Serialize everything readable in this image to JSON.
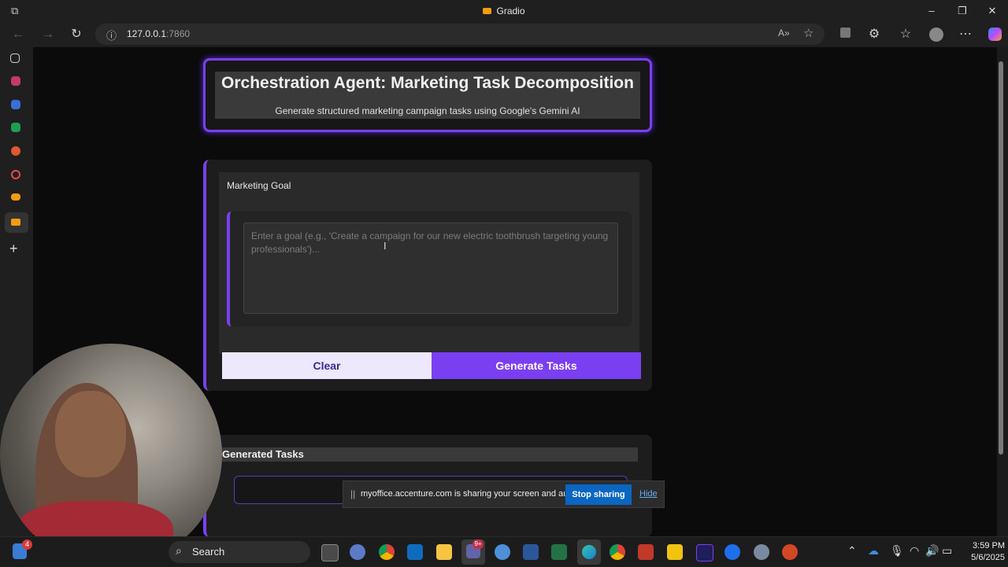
{
  "window": {
    "title": "Gradio",
    "controls": {
      "minimize": "–",
      "restore": "❐",
      "close": "✕"
    }
  },
  "browser": {
    "url_host": "127.0.0.1",
    "url_port": ":7860",
    "icons": [
      "back-icon",
      "forward-icon",
      "refresh-icon",
      "info-icon",
      "read-aloud-icon",
      "favorite-star-icon",
      "extensions-icon",
      "favorites-icon",
      "profile-icon",
      "more-icon",
      "copilot-icon"
    ]
  },
  "header": {
    "title": "Orchestration Agent: Marketing Task Decomposition",
    "subtitle": "Generate structured marketing campaign tasks using Google's Gemini AI"
  },
  "goal": {
    "label": "Marketing Goal",
    "placeholder": "Enter a goal (e.g., 'Create a campaign for our new electric toothbrush targeting young professionals')...",
    "value": ""
  },
  "buttons": {
    "clear": "Clear",
    "generate": "Generate Tasks"
  },
  "tasks": {
    "heading": "Generated Tasks"
  },
  "sharing": {
    "message": "myoffice.accenture.com is sharing your screen and audio.",
    "stop_label": "Stop sharing",
    "hide_label": "Hide"
  },
  "taskbar": {
    "search_label": "Search",
    "time": "3:59 PM",
    "date": "5/6/2025",
    "notification_badge": "4",
    "teams_badge": "9+"
  },
  "colors": {
    "accent": "#7b3ff2",
    "page_bg": "#0b0b0b",
    "card_bg": "#1d1d1d",
    "stop_button": "#0a66c2"
  }
}
